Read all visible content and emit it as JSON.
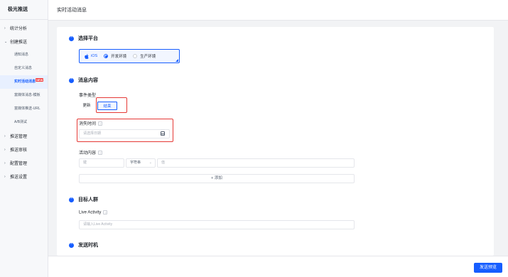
{
  "sidebar": {
    "brand": "极光推送",
    "groups": [
      {
        "label": "统计分析",
        "arrow": "›"
      },
      {
        "label": "创建推送",
        "arrow": "⌄"
      }
    ],
    "sub_items": [
      {
        "label": "通知消息"
      },
      {
        "label": "自定义消息"
      },
      {
        "label": "实时活动消息",
        "badge": "NEW"
      },
      {
        "label": "富媒体消息-模板"
      },
      {
        "label": "富媒体推送-URL"
      },
      {
        "label": "A/B测试"
      }
    ],
    "bottom_groups": [
      {
        "label": "推送管理",
        "arrow": "›"
      },
      {
        "label": "推送审核",
        "arrow": "›"
      },
      {
        "label": "配置管理",
        "arrow": "›"
      },
      {
        "label": "推送设置",
        "arrow": "›"
      }
    ]
  },
  "header": {
    "title": "实时活动消息"
  },
  "platform": {
    "section_title": "选择平台",
    "os_label": "iOS",
    "env_dev": "开发环境",
    "env_prod": "生产环境"
  },
  "message": {
    "section_title": "消息内容",
    "event_type_label": "事件类型",
    "update_label": "更新",
    "end_label": "结束",
    "dismiss_time_label": "消失时间",
    "dismiss_placeholder": "请选择日期",
    "activity_content_label": "活动内容",
    "key_placeholder": "键",
    "type_select": "字符串",
    "value_placeholder": "值",
    "add_label": "+ 添加"
  },
  "audience": {
    "section_title": "目标人群",
    "live_activity_label": "Live Activity",
    "live_activity_placeholder": "请输入Live Activity"
  },
  "send_time": {
    "section_title": "发送时机"
  },
  "footer": {
    "send_preview": "发送预览"
  },
  "colors": {
    "accent": "#165dff",
    "highlight": "#e53935",
    "badge": "#f53f3f"
  },
  "icons": [
    "apple-icon",
    "calendar-icon",
    "help-icon",
    "chevron-down-icon",
    "collapse-icon"
  ]
}
